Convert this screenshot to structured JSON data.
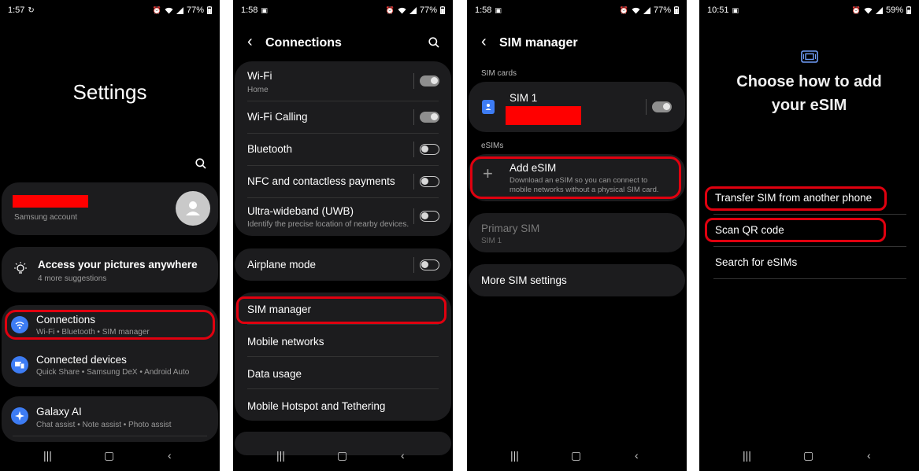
{
  "colors": {
    "background": "#000000",
    "card": "#1c1c1e",
    "highlight": "#e0000f",
    "accent_blue": "#3d7cf4"
  },
  "screen1": {
    "status": {
      "time": "1:57",
      "battery": "77%"
    },
    "title": "Settings",
    "account": {
      "label": "Samsung account"
    },
    "suggestion": {
      "title": "Access your pictures anywhere",
      "sub": "4 more suggestions"
    },
    "items": [
      {
        "title": "Connections",
        "sub": "Wi-Fi  •  Bluetooth  •  SIM manager",
        "icon": "wifi-icon"
      },
      {
        "title": "Connected devices",
        "sub": "Quick Share  •  Samsung DeX  •  Android Auto",
        "icon": "devices-icon"
      },
      {
        "title": "Galaxy AI",
        "sub": "Chat assist  •  Note assist  •  Photo assist",
        "icon": "sparkle-icon"
      }
    ]
  },
  "screen2": {
    "status": {
      "time": "1:58",
      "battery": "77%"
    },
    "title": "Connections",
    "group1": [
      {
        "title": "Wi-Fi",
        "sub": "Home",
        "toggle": "on"
      },
      {
        "title": "Wi-Fi Calling",
        "sub": "",
        "toggle": "on"
      },
      {
        "title": "Bluetooth",
        "sub": "",
        "toggle": "off"
      },
      {
        "title": "NFC and contactless payments",
        "sub": "",
        "toggle": "off"
      },
      {
        "title": "Ultra-wideband (UWB)",
        "sub": "Identify the precise location of nearby devices.",
        "toggle": "off"
      }
    ],
    "airplane": {
      "title": "Airplane mode",
      "toggle": "off"
    },
    "group3": [
      "SIM manager",
      "Mobile networks",
      "Data usage",
      "Mobile Hotspot and Tethering"
    ]
  },
  "screen3": {
    "status": {
      "time": "1:58",
      "battery": "77%"
    },
    "title": "SIM manager",
    "sim_cards_label": "SIM cards",
    "sim1": "SIM 1",
    "esims_label": "eSIMs",
    "add_esim": {
      "title": "Add eSIM",
      "sub1": "Download an eSIM so you can connect to",
      "sub2": "mobile networks without a physical SIM card."
    },
    "primary": {
      "title": "Primary SIM",
      "sub": "SIM 1"
    },
    "more": "More SIM settings"
  },
  "screen4": {
    "status": {
      "time": "10:51",
      "battery": "59%"
    },
    "title_line1": "Choose how to add",
    "title_line2": "your eSIM",
    "options": [
      "Transfer SIM from another phone",
      "Scan QR code",
      "Search for eSIMs"
    ]
  }
}
